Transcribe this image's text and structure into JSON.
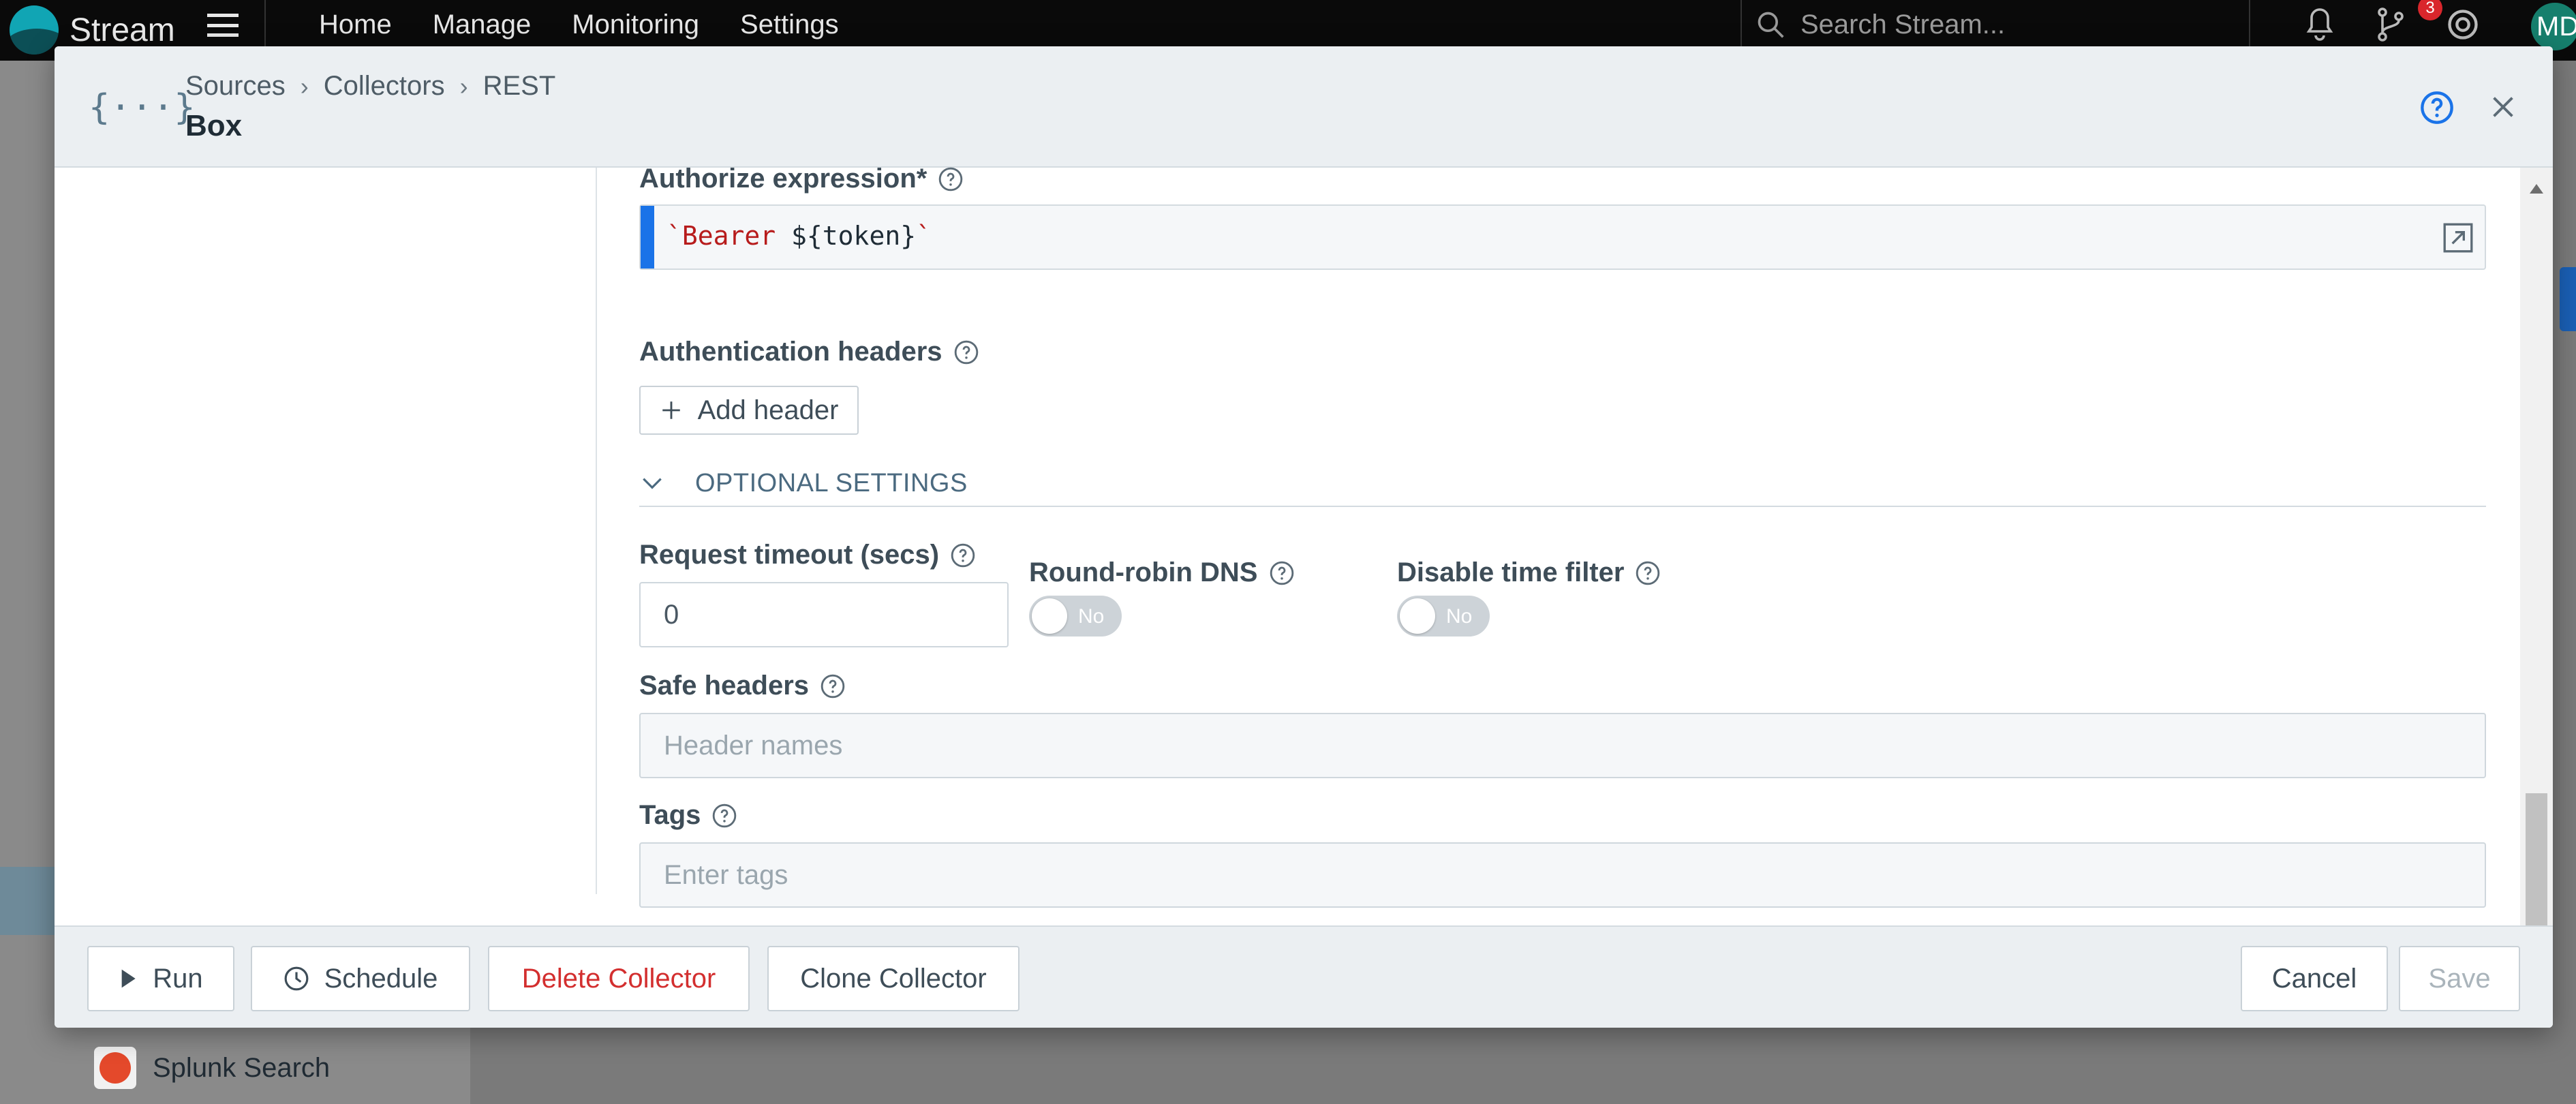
{
  "topnav": {
    "brand": "Stream",
    "links": [
      "Home",
      "Manage",
      "Monitoring",
      "Settings"
    ],
    "search_placeholder": "Search Stream...",
    "notification_count": "3",
    "avatar_initials": "MD"
  },
  "background": {
    "sidebar_item": "Splunk Search"
  },
  "modal": {
    "breadcrumb": [
      "Sources",
      "Collectors",
      "REST"
    ],
    "title": "Box",
    "fields": {
      "authorize_label": "Authorize expression*",
      "authorize_code_quote_open": "`",
      "authorize_code_keyword": "Bearer",
      "authorize_code_value": " ${token}",
      "authorize_code_quote_close": "`",
      "auth_headers_label": "Authentication headers",
      "add_header_label": "Add header",
      "optional_section": "OPTIONAL SETTINGS",
      "request_timeout_label": "Request timeout (secs)",
      "request_timeout_value": "0",
      "round_robin_label": "Round-robin DNS",
      "round_robin_value": "No",
      "disable_time_filter_label": "Disable time filter",
      "disable_time_filter_value": "No",
      "safe_headers_label": "Safe headers",
      "safe_headers_placeholder": "Header names",
      "tags_label": "Tags",
      "tags_placeholder": "Enter tags"
    },
    "footer": {
      "run": "Run",
      "schedule": "Schedule",
      "delete": "Delete Collector",
      "clone": "Clone Collector",
      "cancel": "Cancel",
      "save": "Save"
    }
  },
  "colors": {
    "accent": "#1a73e8",
    "danger": "#d32f2f",
    "toggle_off": "#cdd3d8"
  }
}
